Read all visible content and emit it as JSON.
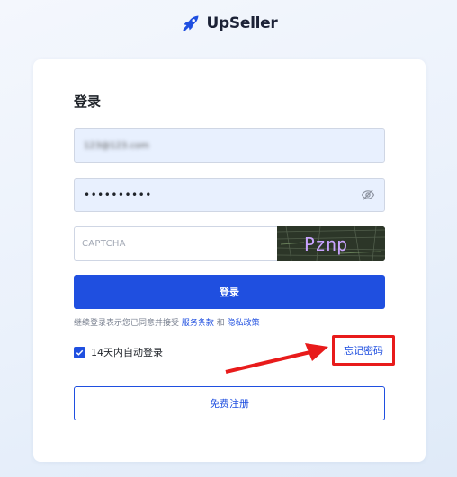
{
  "logo": {
    "text": "UpSeller",
    "icon": "rocket-icon",
    "brand_color": "#1f4fe0"
  },
  "login": {
    "title": "登录",
    "email": {
      "value": "123@123.com"
    },
    "password": {
      "value": "••••••••••"
    },
    "captcha": {
      "placeholder": "CAPTCHA",
      "image_text": "Pznp"
    },
    "submit_label": "登录",
    "terms": {
      "prefix": "继续登录表示您已同意并接受 ",
      "service_link": "服务条款",
      "and": " 和 ",
      "privacy_link": "隐私政策"
    },
    "remember_label": "14天内自动登录",
    "remember_checked": true,
    "forgot_label": "忘记密码",
    "register_label": "免费注册"
  },
  "annotation": {
    "highlight_color": "#e81b1b"
  }
}
